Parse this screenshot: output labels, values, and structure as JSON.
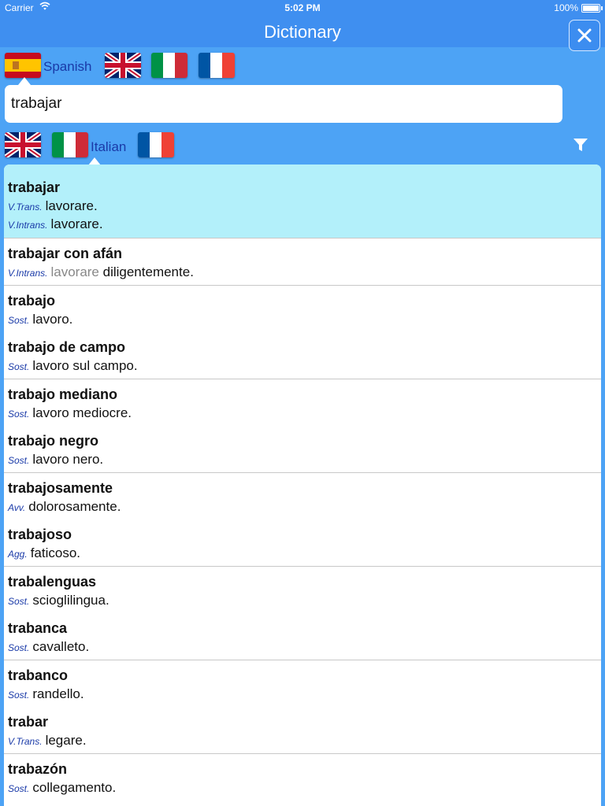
{
  "status_bar": {
    "carrier": "Carrier",
    "time": "5:02 PM",
    "battery": "100%"
  },
  "nav": {
    "title": "Dictionary"
  },
  "source_languages": {
    "selected_label": "Spanish",
    "flags": [
      "spain-flag-icon",
      "uk-flag-icon",
      "italy-flag-icon",
      "france-flag-icon"
    ]
  },
  "search": {
    "value": "trabajar"
  },
  "target_languages": {
    "selected_label": "Italian",
    "flags": [
      "uk-flag-icon",
      "italy-flag-icon",
      "france-flag-icon"
    ]
  },
  "colors": {
    "background": "#4da3f5",
    "bar": "#3f8ff0",
    "highlight": "#b3f0fa",
    "pos_label": "#1a3aa8"
  },
  "results": [
    {
      "word": "trabajar",
      "senses": [
        {
          "pos": "V.Trans.",
          "text": "lavorare."
        },
        {
          "pos": "V.Intrans.",
          "text": "lavorare."
        }
      ]
    },
    {
      "word": "trabajar con afán",
      "senses": [
        {
          "pos": "V.Intrans.",
          "gray": "lavorare",
          "text": " diligentemente."
        }
      ]
    },
    {
      "word": "trabajo",
      "senses": [
        {
          "pos": "Sost.",
          "text": "lavoro."
        }
      ]
    },
    {
      "word": "trabajo de campo",
      "senses": [
        {
          "pos": "Sost.",
          "text": "lavoro sul campo."
        }
      ]
    },
    {
      "word": "trabajo mediano",
      "senses": [
        {
          "pos": "Sost.",
          "text": "lavoro mediocre."
        }
      ]
    },
    {
      "word": "trabajo negro",
      "senses": [
        {
          "pos": "Sost.",
          "text": "lavoro nero."
        }
      ]
    },
    {
      "word": "trabajosamente",
      "senses": [
        {
          "pos": "Avv.",
          "text": "dolorosamente."
        }
      ]
    },
    {
      "word": "trabajoso",
      "senses": [
        {
          "pos": "Agg.",
          "text": "faticoso."
        }
      ]
    },
    {
      "word": "trabalenguas",
      "senses": [
        {
          "pos": "Sost.",
          "text": "scioglilingua."
        }
      ]
    },
    {
      "word": "trabanca",
      "senses": [
        {
          "pos": "Sost.",
          "text": "cavalleto."
        }
      ]
    },
    {
      "word": "trabanco",
      "senses": [
        {
          "pos": "Sost.",
          "text": "randello."
        }
      ]
    },
    {
      "word": "trabar",
      "senses": [
        {
          "pos": "V.Trans.",
          "text": "legare."
        }
      ]
    },
    {
      "word": "trabazón",
      "senses": [
        {
          "pos": "Sost.",
          "text": "collegamento."
        }
      ]
    }
  ]
}
